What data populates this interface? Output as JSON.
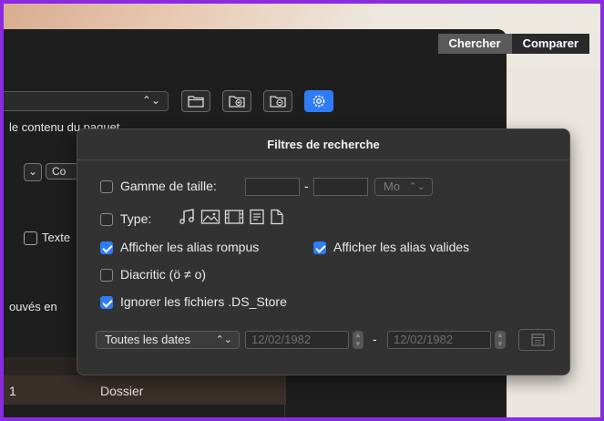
{
  "tabs": [
    "Chercher",
    "Comparer"
  ],
  "background": {
    "content_label": "le contenu du paquet",
    "texte_label": "Texte",
    "found_label": "ouvés en",
    "row_number": "1",
    "row_kind": "Dossier",
    "small_select": "Co"
  },
  "popover": {
    "title": "Filtres de recherche",
    "size_range": {
      "label": "Gamme de taille:",
      "min_value": "",
      "max_value": "",
      "separator": "-",
      "unit": "Mo",
      "checked": false
    },
    "type": {
      "label": "Type:",
      "checked": false,
      "icons": [
        "music-note-icon",
        "image-icon",
        "film-icon",
        "text-document-icon",
        "blank-document-icon"
      ]
    },
    "show_broken_aliases": {
      "label": "Afficher les alias rompus",
      "checked": true
    },
    "show_valid_aliases": {
      "label": "Afficher les alias valides",
      "checked": true
    },
    "diacritic": {
      "label": "Diacritic (ö ≠ o)",
      "checked": false
    },
    "ignore_ds_store": {
      "label": "Ignorer les fichiers .DS_Store",
      "checked": true
    },
    "dates": {
      "selected": "Toutes les dates",
      "start": "12/02/1982",
      "separator": "-",
      "end": "12/02/1982"
    }
  },
  "colors": {
    "accent": "#2f7cf6",
    "window_bg": "#1e1e1e",
    "popover_bg": "#323232",
    "frame": "#8a2be2"
  }
}
